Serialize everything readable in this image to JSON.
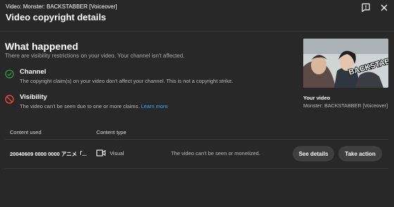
{
  "header": {
    "supertitle": "Video: Monster: BACKSTABBER [Voiceover]",
    "title": "Video copyright details",
    "icons": [
      "feedback-icon",
      "close-icon"
    ]
  },
  "what_happened": {
    "title": "What happened",
    "subtitle": "There are visibility restrictions on your video. Your channel isn't affected.",
    "channel": {
      "label": "Channel",
      "description": "The copyright claim(s) on your video don't affect your channel. This is not a copyright strike.",
      "status_color": "#2ba640"
    },
    "visibility": {
      "label": "Visibility",
      "description": "The video can't be seen due to one or more claims. ",
      "link": "Learn more",
      "status_color": "#ff4e45"
    }
  },
  "your_video": {
    "label": "Your video",
    "title": "Monster: BACKSTABBER [Voiceover]",
    "thumbnail_text": "BACKSTABBER"
  },
  "table": {
    "headers": {
      "content_used": "Content used",
      "content_type": "Content type"
    },
    "rows": [
      {
        "content_used": "20040609 0000 0000 アニメ「...",
        "content_type": "Visual",
        "impact": "The video can't be seen or monetized.",
        "see_details": "See details",
        "take_action": "Take action"
      }
    ]
  }
}
